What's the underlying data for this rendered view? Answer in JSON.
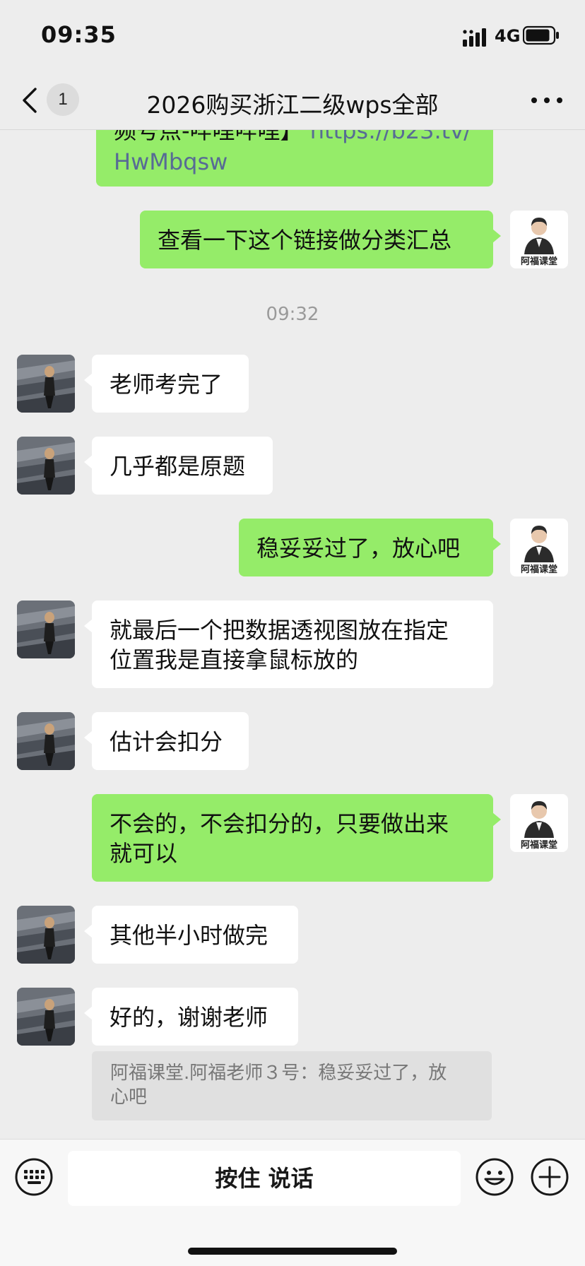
{
  "status_bar": {
    "time": "09:35",
    "network": "4G"
  },
  "nav": {
    "unread_count": "1",
    "title": "2026购买浙江二级wps全部"
  },
  "partial_message": {
    "line1": "频号点-哔哩哔哩】",
    "line1_link": " https://b23.tv/",
    "line2": "HwMbqsw"
  },
  "timestamp": "09:32",
  "messages": [
    {
      "side": "out",
      "text": "查看一下这个链接做分类汇总"
    },
    {
      "side": "in",
      "text": "老师考完了"
    },
    {
      "side": "in",
      "text": "几乎都是原题"
    },
    {
      "side": "out",
      "text": "稳妥妥过了，放心吧"
    },
    {
      "side": "in",
      "line1": "就最后一个把数据透视图放在指定",
      "line2": "位置我是直接拿鼠标放的"
    },
    {
      "side": "in",
      "text": "估计会扣分"
    },
    {
      "side": "out",
      "line1": "不会的，不会扣分的，只要做出来",
      "line2": "就可以"
    },
    {
      "side": "in",
      "text": "其他半小时做完"
    },
    {
      "side": "in",
      "text": "好的，谢谢老师"
    }
  ],
  "quote": {
    "line1": "阿福课堂.阿福老师３号：稳妥妥过了，放",
    "line2": "心吧"
  },
  "teacher_avatar_label": "阿福课堂",
  "input_bar": {
    "hold_to_talk": "按住 说话"
  },
  "colors": {
    "outgoing_bubble": "#95ec69",
    "incoming_bubble": "#ffffff",
    "background": "#ededed",
    "link": "#576b95"
  }
}
